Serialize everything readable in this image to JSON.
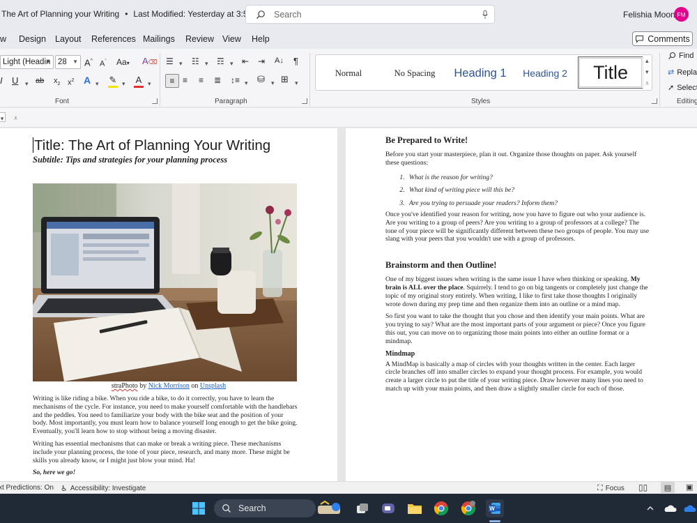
{
  "titlebar": {
    "doc_name": "The Art of Planning your Writing",
    "modified": "Last Modified: Yesterday at 3:54 PM",
    "search_placeholder": "Search",
    "user_name": "Felishia Moon",
    "avatar_initials": "FM",
    "avatar_color": "#e3008c"
  },
  "menu": {
    "items": [
      "w",
      "Design",
      "Layout",
      "References",
      "Mailings",
      "Review",
      "View",
      "Help"
    ],
    "comments_label": "Comments"
  },
  "ribbon": {
    "font_name": "Light (Headin",
    "font_size": "28",
    "groups": {
      "font": "Font",
      "paragraph": "Paragraph",
      "styles": "Styles",
      "editing": "Editing"
    },
    "styles": [
      "Normal",
      "No Spacing",
      "Heading 1",
      "Heading 2",
      "Title"
    ],
    "editing": {
      "find": "Find",
      "replace": "Repla",
      "select": "Select"
    }
  },
  "page1": {
    "title": "Title: The Art of Planning Your Writing",
    "subtitle": "Subtitle: Tips and strategies for your planning process",
    "caption": {
      "photo_by": "straPhoto",
      "by": " by ",
      "author": "Nick Morrison",
      "on": " on ",
      "site": "Unsplash"
    },
    "paragraphs": [
      "Writing is like riding a bike. When you ride a bike, to do it correctly, you have to learn the mechanisms of the cycle. For instance, you need to make yourself comfortable with the handlebars and the peddles. You need to familiarize your body with the bike seat and the position of your body. Most importantly, you must learn how to balance yourself long enough to get the bike going. Eventually, you'll learn how to stop without being a moving disaster.",
      "Writing has essential mechanisms that can make or break a writing piece. These mechanisms include your planning process, the tone of your piece, research, and many more. These might be skills you already know, or I might just blow your mind. Ha!"
    ],
    "closing": "So, here we go!"
  },
  "page2": {
    "section1": {
      "heading": "Be Prepared to Write!",
      "intro": "Before you start your masterpiece, plan it out. Organize those thoughts on paper. Ask yourself these questions:",
      "questions": [
        "What is the reason for writing?",
        "What kind of writing piece will this be?",
        "Are you trying to persuade your readers? Inform them?"
      ],
      "body": "Once you've identified your reason for writing, now you have to figure out who your audience is. Are you writing to a group of peers? Are you writing to a group of professors at a college? The tone of your piece will be significantly different between these two groups of people. You may use slang with your peers that you wouldn't use with a group of professors."
    },
    "section2": {
      "heading": "Brainstorm and then Outline!",
      "p1_a": "One of my biggest issues when writing is the same issue I have when thinking or speaking. ",
      "p1_bold": "My brain is ALL over the place",
      "p1_b": ". Squirrely. I tend to go on big tangents or completely just change the topic of my original story entirely. When writing, I like to first take those thoughts I originally wrote down during my prep time and then organize them into an outline or a mind map.",
      "p2": "So first you want to take the thought that you chose and then identify your main points. What are you trying to say? What are the most important parts of your argument or piece? Once you figure this out, you can move on to organizing those main points into either an outline format or a mindmap.",
      "subheading": "Mindmap",
      "p3": "A MindMap is basically a map of circles with your thoughts written in the center. Each larger circle branches off into smaller circles to expand your thought process. For example, you would create a larger circle to put the title of your writing piece. Draw however many lines you need to match up with your main points, and then draw a slightly smaller circle for each of those."
    }
  },
  "statusbar": {
    "predictions": "xt Predictions: On",
    "accessibility": "Accessibility: Investigate",
    "focus": "Focus"
  },
  "taskbar": {
    "search_label": "Search"
  }
}
